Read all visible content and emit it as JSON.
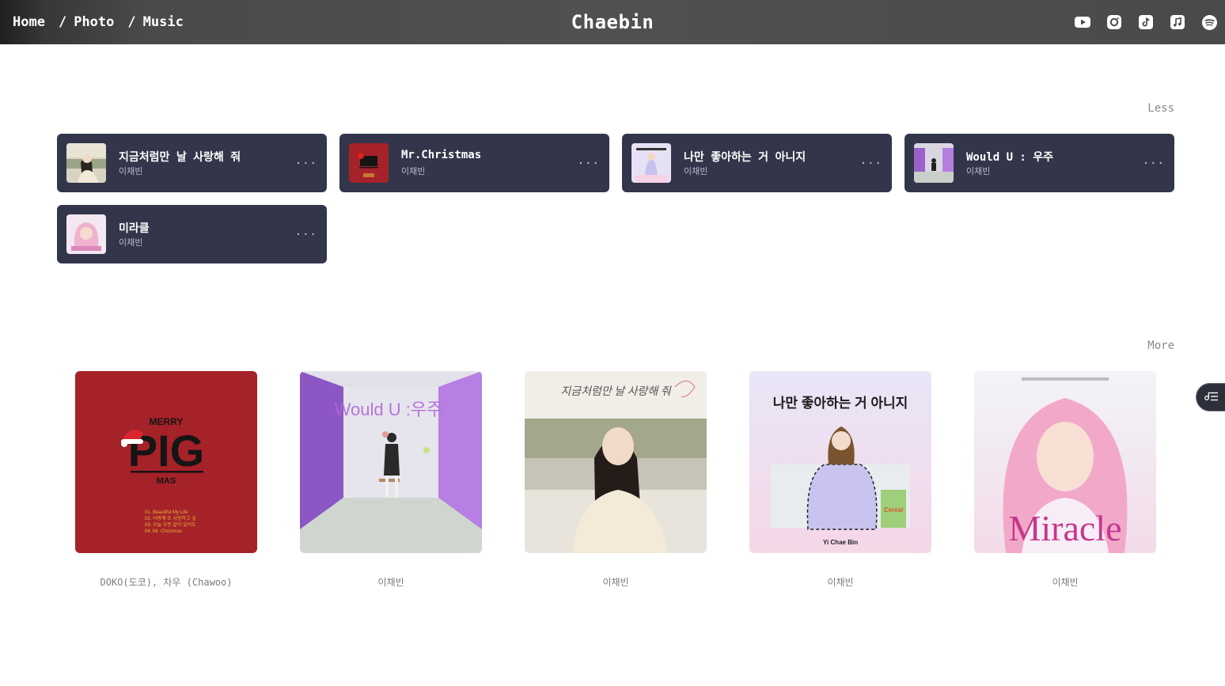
{
  "nav": {
    "crumbs": [
      "Home",
      "/",
      "Photo",
      "/",
      "Music"
    ],
    "brand": "Chaebin",
    "social": [
      "youtube-icon",
      "instagram-icon",
      "tiktok-icon",
      "apple-music-icon",
      "spotify-icon"
    ]
  },
  "tracks_section": {
    "toggle_label": "Less",
    "tracks": [
      {
        "title": "지금처럼만 날 사랑해 줘",
        "artist": "이채빈",
        "more": "..."
      },
      {
        "title": "Mr.Christmas",
        "artist": "이채빈",
        "more": "..."
      },
      {
        "title": "나만 좋아하는 거 아니지",
        "artist": "이채빈",
        "more": "..."
      },
      {
        "title": "Would U : 우주",
        "artist": "이채빈",
        "more": "..."
      },
      {
        "title": "미라클",
        "artist": "이채빈",
        "more": "..."
      }
    ]
  },
  "albums_section": {
    "toggle_label": "More",
    "albums": [
      {
        "artist": "DOKO(도코), 차우 (Chawoo)",
        "cover_text": [
          "MERRY",
          "PIG",
          "MAS"
        ],
        "track_list": [
          "01. Beautiful My Life",
          "02. 사랑해 또 사랑하고 싶",
          "03. 오늘 우린 같이 있어도",
          "04. Mr. Christmas"
        ]
      },
      {
        "artist": "이채빈",
        "cover_text": [
          "Would U :우주"
        ]
      },
      {
        "artist": "이채빈",
        "cover_text": [
          "지금처럼만 날 사랑해 줘"
        ]
      },
      {
        "artist": "이채빈",
        "cover_text": [
          "나만 좋아하는 거 아니지",
          "Yi Chae Bin",
          "Cereal"
        ]
      },
      {
        "artist": "이채빈",
        "cover_text": [
          "Miracle"
        ]
      }
    ]
  },
  "colors": {
    "card_bg": "#33364a",
    "header_bg": "#505050",
    "christmas_red": "#a52228"
  }
}
